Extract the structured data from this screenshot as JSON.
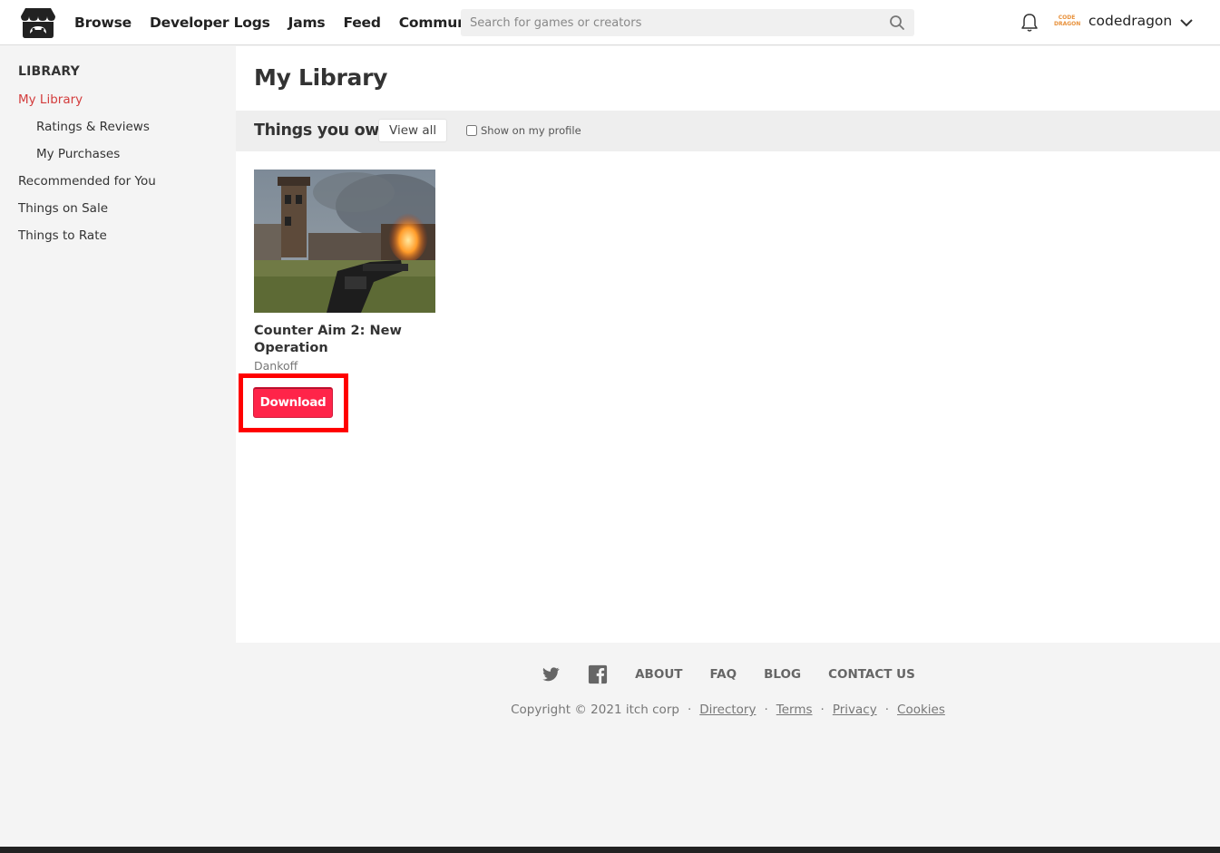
{
  "header": {
    "nav": [
      "Browse",
      "Developer Logs",
      "Jams",
      "Feed",
      "Community"
    ],
    "search_placeholder": "Search for games or creators",
    "username": "codedragon",
    "avatar_text": "CODE DRAGON"
  },
  "sidebar": {
    "heading": "LIBRARY",
    "items": [
      {
        "label": "My Library",
        "active": true
      },
      {
        "label": "Ratings & Reviews"
      },
      {
        "label": "My Purchases"
      },
      {
        "label": "Recommended for You"
      },
      {
        "label": "Things on Sale"
      },
      {
        "label": "Things to Rate"
      }
    ]
  },
  "main": {
    "title": "My Library",
    "owned": {
      "title": "Things you own",
      "view_all": "View all",
      "show_on_profile": "Show on my profile"
    },
    "games": [
      {
        "title": "Counter Aim 2: New Operation",
        "author": "Dankoff",
        "button": "Download"
      }
    ]
  },
  "footer": {
    "links": [
      "ABOUT",
      "FAQ",
      "BLOG",
      "CONTACT US"
    ],
    "copyright": "Copyright © 2021 itch corp",
    "legal": [
      "Directory",
      "Terms",
      "Privacy",
      "Cookies"
    ]
  },
  "colors": {
    "accent_red": "#ff2449",
    "active_link": "#d33c3c",
    "highlight": "#ff0000"
  }
}
